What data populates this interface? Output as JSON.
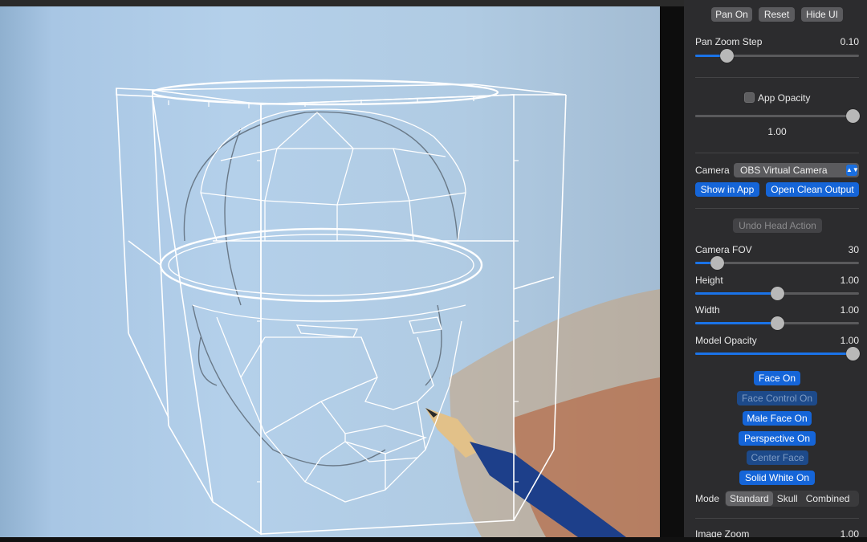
{
  "toolbar": {
    "pan_on": "Pan On",
    "reset": "Reset",
    "hide_ui": "Hide UI"
  },
  "pan_zoom_step": {
    "label": "Pan Zoom Step",
    "value": "0.10",
    "fraction": 0.19
  },
  "app_opacity": {
    "label": "App Opacity",
    "checked": false,
    "value": "1.00",
    "fraction": 1.0
  },
  "camera": {
    "label": "Camera",
    "selected": "OBS Virtual Camera",
    "show_in_app": "Show in App",
    "open_clean_output": "Open Clean Output"
  },
  "undo_head_action": "Undo Head Action",
  "sliders": {
    "camera_fov": {
      "label": "Camera FOV",
      "value": "30",
      "fraction": 0.13
    },
    "height": {
      "label": "Height",
      "value": "1.00",
      "fraction": 0.5
    },
    "width": {
      "label": "Width",
      "value": "1.00",
      "fraction": 0.5
    },
    "model_opacity": {
      "label": "Model Opacity",
      "value": "1.00",
      "fraction": 1.0
    }
  },
  "toggles": {
    "face_on": "Face On",
    "face_control_on": "Face Control On",
    "male_face_on": "Male Face On",
    "perspective_on": "Perspective On",
    "center_face": "Center Face",
    "solid_white_on": "Solid White On"
  },
  "mode": {
    "label": "Mode",
    "options": [
      "Standard",
      "Skull",
      "Combined"
    ],
    "selected": "Standard"
  },
  "image_zoom": {
    "label": "Image Zoom",
    "value": "1.00"
  },
  "colors": {
    "accent": "#1565d8",
    "panel": "#2c2c2e",
    "wire": "#ffffff"
  }
}
